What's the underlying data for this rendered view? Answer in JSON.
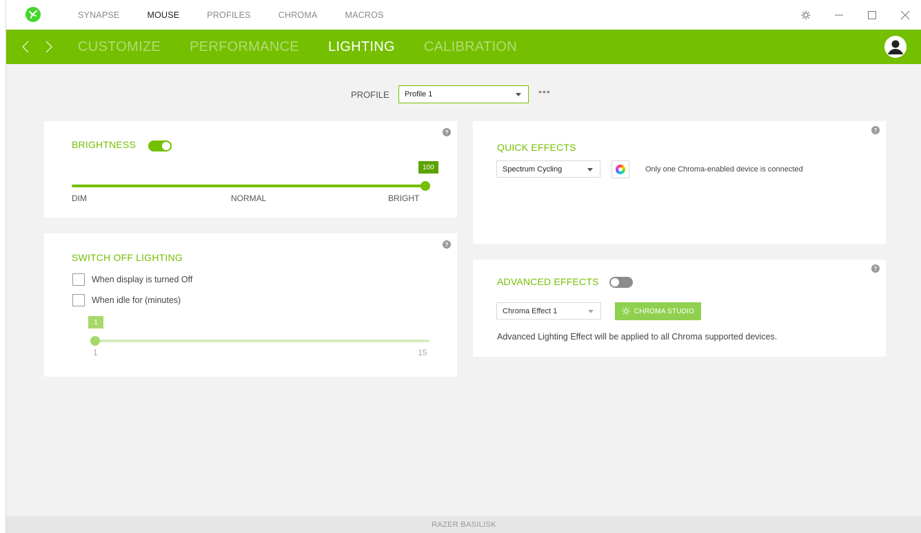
{
  "topnav": {
    "items": [
      "SYNAPSE",
      "MOUSE",
      "PROFILES",
      "CHROMA",
      "MACROS"
    ],
    "active_index": 1
  },
  "window_controls": [
    "settings-icon",
    "minimize-icon",
    "maximize-icon",
    "close-icon"
  ],
  "subnav": {
    "tabs": [
      "CUSTOMIZE",
      "PERFORMANCE",
      "LIGHTING",
      "CALIBRATION"
    ],
    "active_index": 2
  },
  "profile": {
    "label": "PROFILE",
    "selected": "Profile 1",
    "more": "•••"
  },
  "brightness": {
    "title": "BRIGHTNESS",
    "enabled": true,
    "value": "100",
    "value_fraction": 1.0,
    "labels": {
      "min": "DIM",
      "mid": "NORMAL",
      "max": "BRIGHT"
    }
  },
  "switch_off": {
    "title": "SWITCH OFF LIGHTING",
    "option_display": "When display is turned Off",
    "option_idle": "When idle for (minutes)",
    "idle_value": "1",
    "idle_min": "1",
    "idle_max": "15"
  },
  "quick_effects": {
    "title": "QUICK EFFECTS",
    "selected": "Spectrum Cycling",
    "info": "Only one Chroma-enabled device is connected"
  },
  "advanced_effects": {
    "title": "ADVANCED EFFECTS",
    "enabled": false,
    "selected": "Chroma Effect 1",
    "studio_button": "CHROMA STUDIO",
    "description": "Advanced Lighting Effect will be applied to all Chroma supported devices."
  },
  "help_symbol": "?",
  "footer": {
    "device": "RAZER BASILISK"
  },
  "colors": {
    "accent": "#74bf00",
    "accent_light": "#a6d96a"
  }
}
